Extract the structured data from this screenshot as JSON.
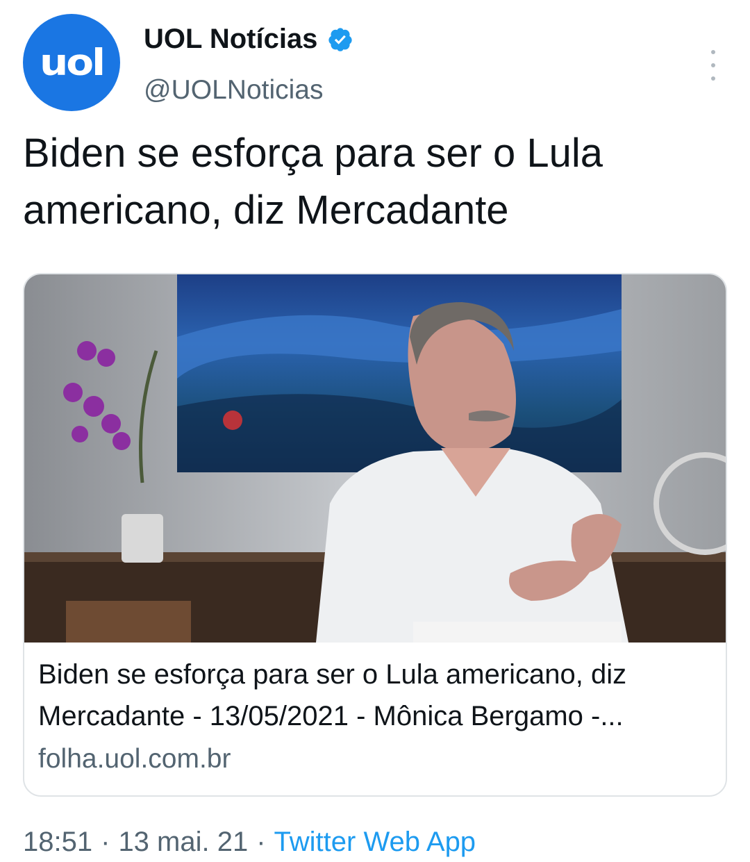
{
  "author": {
    "avatar_text": "uol",
    "display_name": "UOL Notícias",
    "handle": "@UOLNoticias",
    "verified": true,
    "avatar_color": "#1a76e3"
  },
  "tweet": {
    "text_line1": "Biden se esforça para ser o Lula",
    "text_line2": "americano, diz Mercadante"
  },
  "card": {
    "title_line1": "Biden se esforça para ser o Lula americano, diz",
    "title_line2": "Mercadante - 13/05/2021 - Mônica Bergamo -...",
    "domain": "folha.uol.com.br"
  },
  "footer": {
    "time": "18:51",
    "separator": "·",
    "date": "13 mai. 21",
    "source": "Twitter Web App"
  },
  "colors": {
    "accent": "#1d9bf0",
    "secondary_text": "#536471",
    "primary_text": "#0f1419"
  },
  "icons": [
    "verified-badge-icon",
    "more-options-icon"
  ]
}
